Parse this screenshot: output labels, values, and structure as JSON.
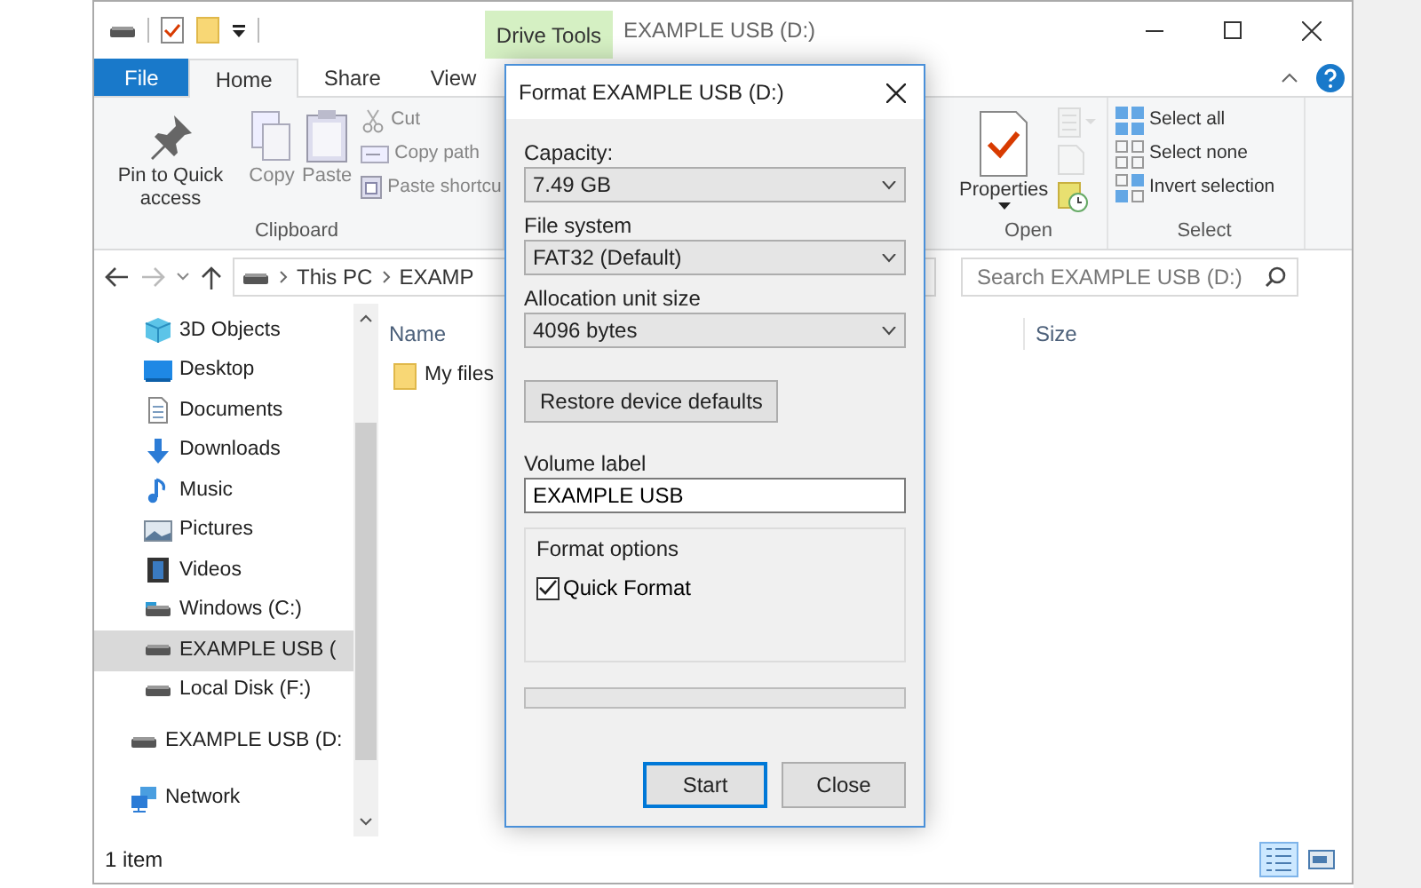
{
  "window": {
    "title": "EXAMPLE USB (D:)",
    "context_tab": "Drive Tools"
  },
  "ribbon_tabs": [
    {
      "label": "File",
      "kind": "file",
      "selected": false
    },
    {
      "label": "Home",
      "kind": "tab",
      "selected": true
    },
    {
      "label": "Share",
      "kind": "tab",
      "selected": false
    },
    {
      "label": "View",
      "kind": "tab",
      "selected": false
    }
  ],
  "ribbon_groups": [
    {
      "title": "Clipboard",
      "buttons": [
        {
          "label": "Pin to Quick access",
          "kind": "large",
          "disabled": false
        },
        {
          "label": "Copy",
          "kind": "large",
          "disabled": true
        },
        {
          "label": "Paste",
          "kind": "large",
          "disabled": true
        },
        {
          "label": "Cut",
          "kind": "small",
          "disabled": true
        },
        {
          "label": "Copy path",
          "kind": "small",
          "disabled": true
        },
        {
          "label": "Paste shortcu",
          "kind": "small",
          "disabled": true
        }
      ]
    },
    {
      "title": "Open",
      "buttons": [
        {
          "label": "Properties",
          "kind": "large",
          "disabled": false
        },
        {
          "kind": "small",
          "disabled": true
        },
        {
          "kind": "small",
          "disabled": true
        },
        {
          "kind": "small",
          "disabled": false
        }
      ]
    },
    {
      "title": "Select",
      "buttons": [
        {
          "label": "Select all",
          "kind": "small",
          "disabled": false
        },
        {
          "label": "Select none",
          "kind": "small",
          "disabled": false
        },
        {
          "label": "Invert selection",
          "kind": "small",
          "disabled": false
        }
      ]
    }
  ],
  "address": {
    "path": [
      "This PC",
      "EXAMP"
    ],
    "search_placeholder": "Search EXAMPLE USB (D:)"
  },
  "nav_pane": {
    "this_pc_children": [
      {
        "label": "3D Objects",
        "selected": false
      },
      {
        "label": "Desktop",
        "selected": false
      },
      {
        "label": "Documents",
        "selected": false
      },
      {
        "label": "Downloads",
        "selected": false
      },
      {
        "label": "Music",
        "selected": false
      },
      {
        "label": "Pictures",
        "selected": false
      },
      {
        "label": "Videos",
        "selected": false
      },
      {
        "label": "Windows (C:)",
        "selected": false
      },
      {
        "label": "EXAMPLE USB (",
        "selected": true
      },
      {
        "label": "Local Disk (F:)",
        "selected": false
      }
    ],
    "items": [
      {
        "label": "EXAMPLE USB (D:",
        "selected": false
      },
      {
        "label": "Network",
        "selected": false
      }
    ]
  },
  "file_list": {
    "columns": [
      "Name",
      "Size"
    ],
    "rows": [
      {
        "name": "My files"
      }
    ]
  },
  "status_bar": {
    "item_count": "1 item",
    "views": [
      {
        "kind": "details",
        "selected": true
      },
      {
        "kind": "large_icons",
        "selected": false
      }
    ]
  },
  "dialog": {
    "title": "Format EXAMPLE USB (D:)",
    "selects": [
      {
        "label": "Capacity:",
        "value": "7.49 GB"
      },
      {
        "label": "File system",
        "value": "FAT32 (Default)"
      },
      {
        "label": "Allocation unit size",
        "value": "4096 bytes"
      }
    ],
    "restore_button": "Restore device defaults",
    "volume_label": {
      "label": "Volume label",
      "value": "EXAMPLE USB"
    },
    "format_options": {
      "title": "Format options",
      "options": [
        {
          "label": "Quick Format",
          "checked": true
        }
      ]
    },
    "progress": {
      "level": 0
    },
    "buttons": [
      {
        "label": "Start",
        "default": true
      },
      {
        "label": "Close",
        "default": false
      }
    ]
  }
}
